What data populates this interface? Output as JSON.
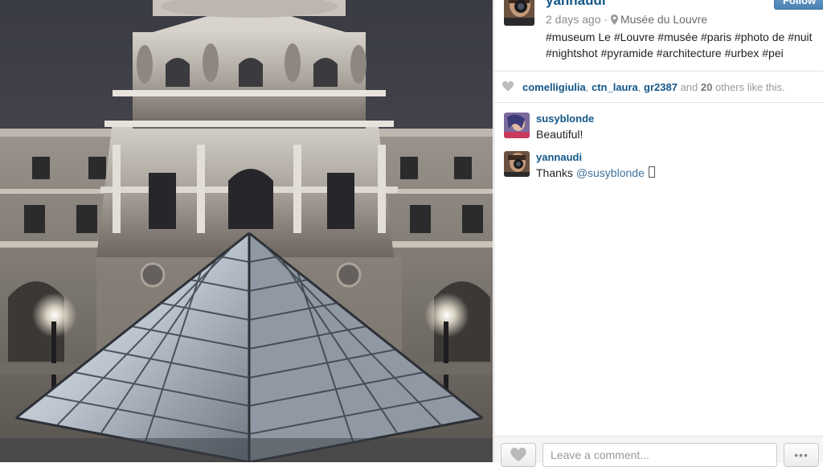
{
  "photo": {
    "subject": "Louvre Pavilion and Pyramid at night"
  },
  "post": {
    "owner": {
      "username": "yannaudi",
      "avatar_icon": "camera-selfie-avatar"
    },
    "follow_label": "Follow",
    "time_ago": "2 days ago",
    "separator": "·",
    "location_icon": "map-pin-icon",
    "location": "Musée du Louvre",
    "caption": "#museum Le #Louvre #musée #paris #photo de #nuit #nightshot #pyramide #architecture #urbex #pei"
  },
  "likes": {
    "icon": "heart-icon",
    "users": [
      "comelligiulia",
      "ctn_laura",
      "gr2387"
    ],
    "sep1": ", ",
    "sep2": ", ",
    "and_word": " and ",
    "others_count": "20",
    "others_suffix": " others like this."
  },
  "comments": [
    {
      "username": "susyblonde",
      "text": "Beautiful!",
      "avatar_icon": "user-avatar"
    },
    {
      "username": "yannaudi",
      "text_prefix": "Thanks ",
      "mention": "@susyblonde",
      "text_suffix": " ",
      "avatar_icon": "camera-selfie-avatar"
    }
  ],
  "footer": {
    "like_icon": "heart-icon",
    "comment_placeholder": "Leave a comment...",
    "more_label": "•••"
  },
  "colors": {
    "link_blue": "#125688",
    "follow_blue": "#4b82b4",
    "muted_grey": "#999999"
  }
}
